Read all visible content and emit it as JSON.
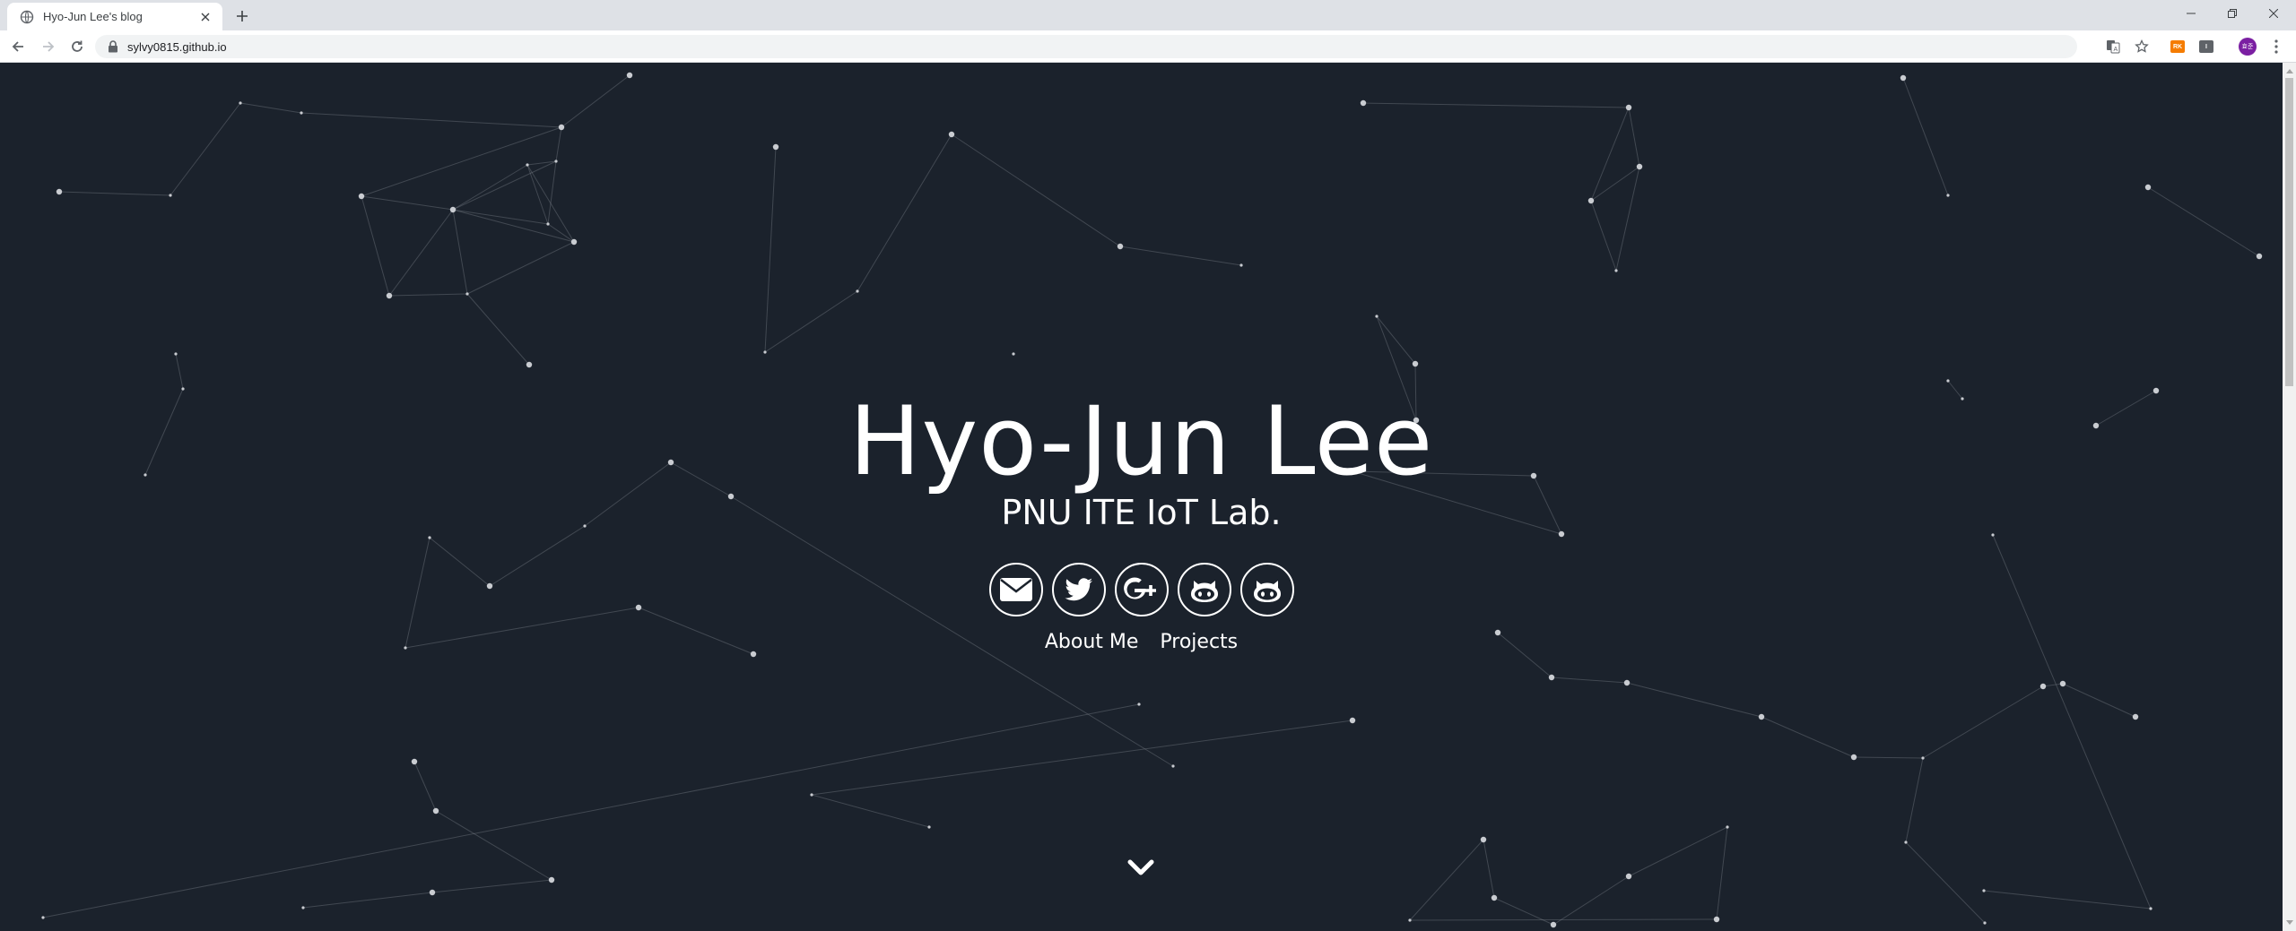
{
  "browser": {
    "tab_title": "Hyo-Jun Lee's blog",
    "url": "sylvy0815.github.io",
    "extensions": [
      {
        "name": "translate-icon"
      },
      {
        "name": "bookmark-star-icon"
      },
      {
        "name": "extension-rk",
        "label": "RK",
        "color": "#f57c00"
      },
      {
        "name": "extension-dark",
        "label": "I",
        "color": "#5f6368"
      }
    ],
    "avatar_label": "효준",
    "avatar_color": "#7b1fa2"
  },
  "hero": {
    "title": "Hyo-Jun Lee",
    "subtitle": "PNU ITE IoT Lab.",
    "socials": [
      "envelope-icon",
      "twitter-icon",
      "google-plus-icon",
      "github-icon",
      "github-icon"
    ],
    "google_plus_label": "G+",
    "links": [
      "About Me",
      "Projects"
    ]
  },
  "colors": {
    "background": "#1b222c",
    "foreground": "#ffffff",
    "particle": "#c9ccd1"
  }
}
